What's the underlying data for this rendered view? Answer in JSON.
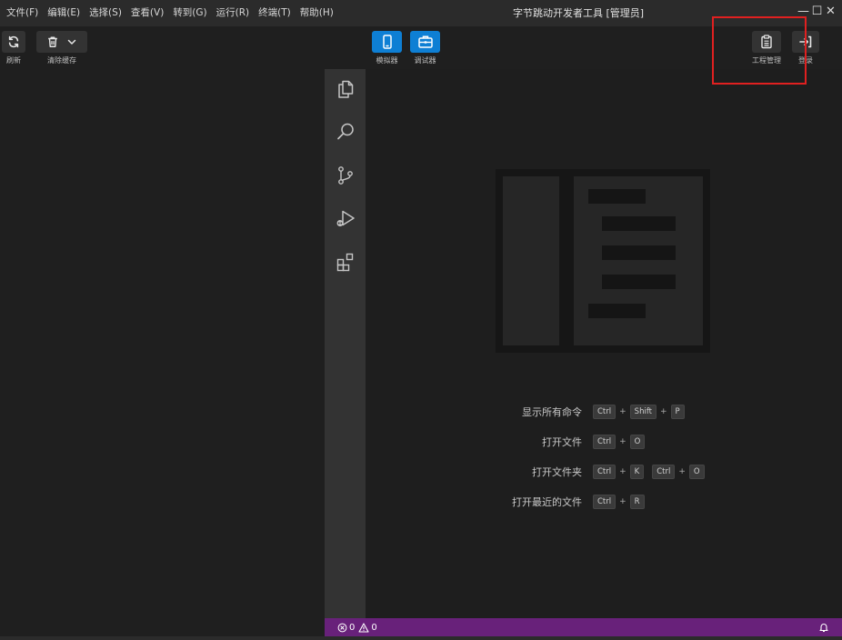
{
  "window": {
    "title": "字节跳动开发者工具 [管理员]",
    "controls": {
      "minimize": "—",
      "maximize": "☐",
      "close": "✕"
    }
  },
  "menu": [
    {
      "label": "文件(F)"
    },
    {
      "label": "编辑(E)"
    },
    {
      "label": "选择(S)"
    },
    {
      "label": "查看(V)"
    },
    {
      "label": "转到(G)"
    },
    {
      "label": "运行(R)"
    },
    {
      "label": "终端(T)"
    },
    {
      "label": "帮助(H)"
    }
  ],
  "toolbar": {
    "refresh_label": "刷新",
    "clear_cache_label": "清除缓存",
    "simulator_label": "模拟器",
    "debugger_label": "调试器",
    "project_manage_label": "工程管理",
    "login_label": "登录"
  },
  "shortcuts": [
    {
      "label": "显示所有命令",
      "keys": [
        [
          "Ctrl",
          "Shift",
          "P"
        ]
      ]
    },
    {
      "label": "打开文件",
      "keys": [
        [
          "Ctrl",
          "O"
        ]
      ]
    },
    {
      "label": "打开文件夹",
      "keys": [
        [
          "Ctrl",
          "K"
        ],
        [
          "Ctrl",
          "O"
        ]
      ]
    },
    {
      "label": "打开最近的文件",
      "keys": [
        [
          "Ctrl",
          "R"
        ]
      ]
    }
  ],
  "status": {
    "errors": "0",
    "warnings": "0"
  },
  "colors": {
    "statusbar": "#68217a",
    "accent_blue": "#0e7fd4",
    "highlight": "#e02020"
  }
}
